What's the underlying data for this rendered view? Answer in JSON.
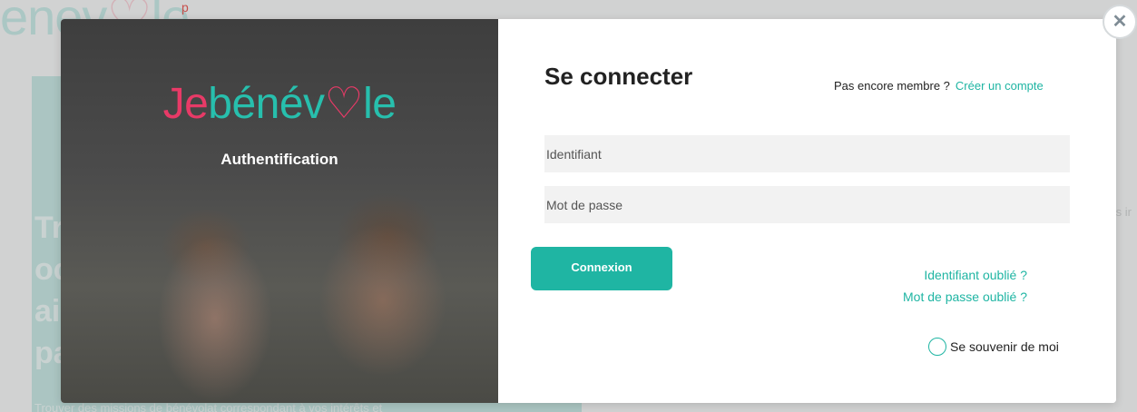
{
  "background": {
    "logo_text": "enev",
    "logo_heart": "♡",
    "logo_tail": "le",
    "top_link": "p",
    "hero_title": "Tr\noc\nai\npa",
    "hero_text": "Trouver des missions de bénévolat correspondant à vos intérêts et",
    "right_text": "ıs ir"
  },
  "brand": {
    "je": "Je",
    "name_start": "bénév",
    "heart": "♡",
    "name_end": "le",
    "subtitle": "Authentification"
  },
  "login": {
    "title": "Se connecter",
    "not_member": "Pas encore membre ?",
    "create_account": "Créer un compte",
    "identifier_placeholder": "Identifiant",
    "password_placeholder": "Mot de passe",
    "submit_label": "Connexion",
    "forgot_identifier": "Identifiant oublié ?",
    "forgot_password": "Mot de passe oublié ?",
    "remember_me": "Se souvenir de moi"
  },
  "close": {
    "icon": "close-icon",
    "glyph": "✕"
  },
  "colors": {
    "accent": "#1fb5a3",
    "brand_pink": "#e83a67",
    "brand_teal": "#27bfad"
  }
}
